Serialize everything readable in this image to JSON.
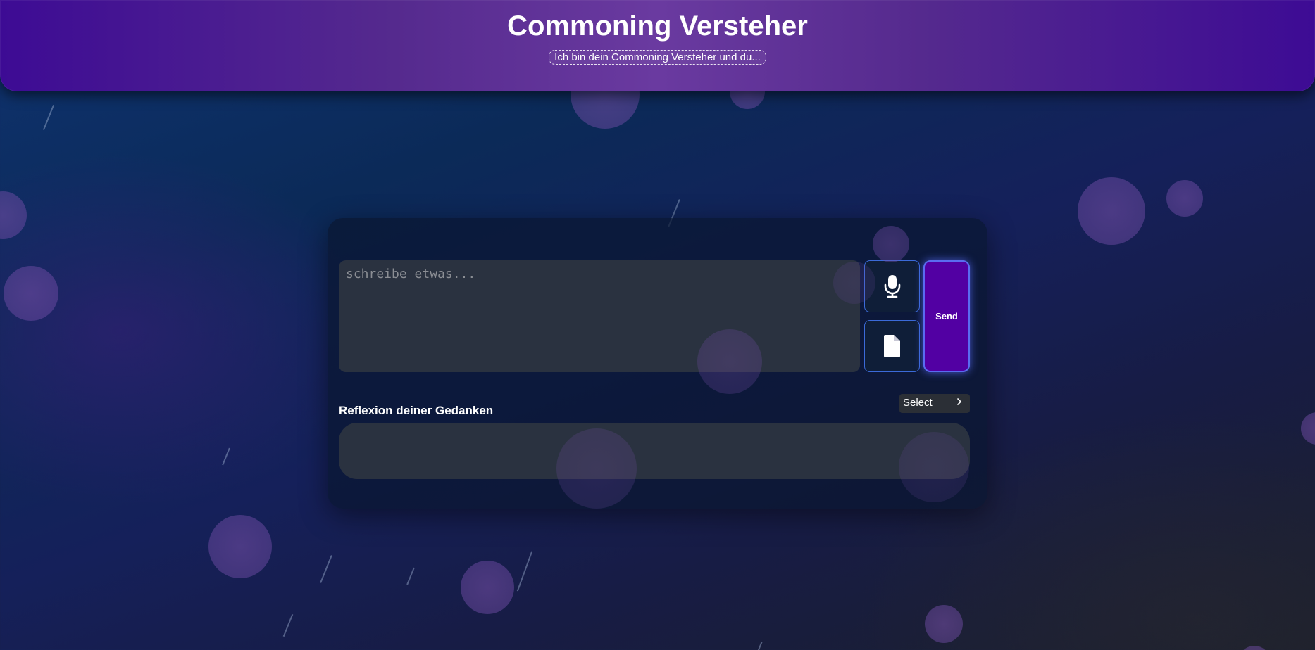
{
  "header": {
    "title": "Commoning Versteher",
    "subtitle": "Ich bin dein Commoning Versteher und du..."
  },
  "composer": {
    "placeholder": "schreibe etwas...",
    "value": "",
    "send_label": "Send",
    "mic_icon": "microphone-icon",
    "file_icon": "file-icon"
  },
  "reflection": {
    "label": "Reflexion deiner Gedanken",
    "select_value": "Select",
    "select_icon": "chevron-right-icon",
    "output": ""
  },
  "colors": {
    "header_gradient": [
      "#3d0b94",
      "#6a3aa0"
    ],
    "send_button": "#5200a3",
    "button_border": "#3b6ad8",
    "input_bg": "#2a3240"
  }
}
